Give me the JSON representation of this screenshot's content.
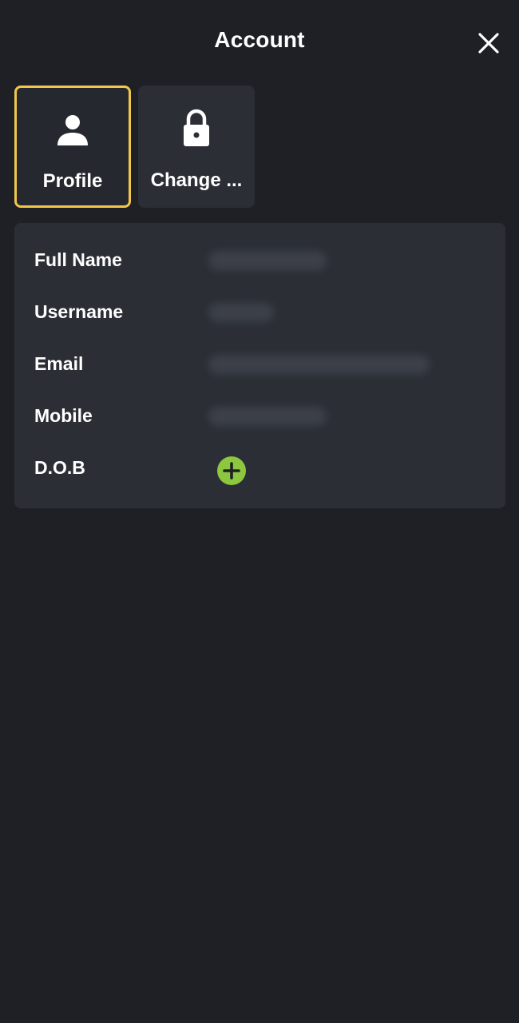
{
  "header": {
    "title": "Account",
    "close_icon": "close-icon"
  },
  "tabs": [
    {
      "label": "Profile",
      "icon": "person-icon",
      "active": true
    },
    {
      "label": "Change ...",
      "icon": "lock-icon",
      "active": false
    }
  ],
  "profile": {
    "fields": [
      {
        "label": "Full Name",
        "value_state": "blurred"
      },
      {
        "label": "Username",
        "value_state": "blurred"
      },
      {
        "label": "Email",
        "value_state": "blurred"
      },
      {
        "label": "Mobile",
        "value_state": "blurred"
      },
      {
        "label": "D.O.B",
        "value_state": "empty",
        "action_icon": "plus-circle-icon"
      }
    ]
  },
  "colors": {
    "background": "#1e2026",
    "card": "#2b2e35",
    "active_border": "#f0c64b",
    "add_button": "#8dc63f"
  }
}
